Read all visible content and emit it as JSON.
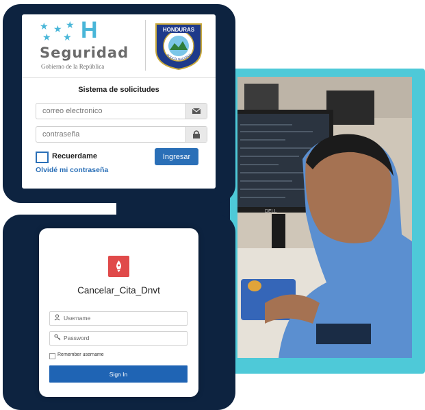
{
  "colors": {
    "navy": "#0d2340",
    "cyan": "#4ec9d8",
    "accent_blue": "#2a6fb7",
    "app_red": "#e04a4a"
  },
  "top_login": {
    "brand": {
      "logo_letter": "H",
      "name": "Seguridad",
      "subtitle": "Gobierno de la República",
      "seal_text": "HONDURAS",
      "seal_ring_text": "POLICÍA NACIONAL"
    },
    "title": "Sistema de solicitudes",
    "email_placeholder": "correo electronico",
    "password_placeholder": "contraseña",
    "email_icon": "envelope-icon",
    "password_icon": "lock-icon",
    "remember_label": "Recuerdame",
    "remember_checked": false,
    "forgot_label": "Olvidé mi contraseña",
    "submit_label": "Ingresar"
  },
  "bottom_login": {
    "app_icon": "rocket-icon",
    "app_title": "Cancelar_Cita_Dnvt",
    "username_placeholder": "Username",
    "password_placeholder": "Password",
    "remember_label": "Remember username",
    "remember_checked": false,
    "submit_label": "Sign In"
  },
  "photo": {
    "subject": "officer-at-computer",
    "monitor_brand": "DELL"
  }
}
